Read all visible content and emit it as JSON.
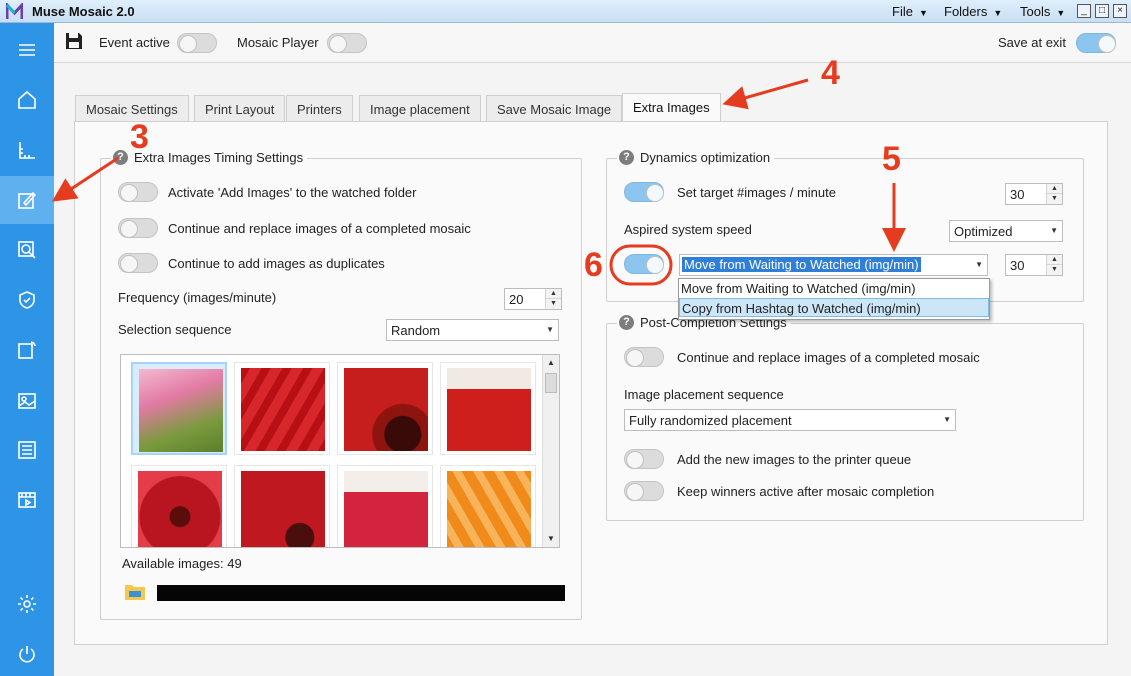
{
  "app": {
    "title": "Muse Mosaic 2.0",
    "menus": [
      "File",
      "Folders",
      "Tools"
    ],
    "window_controls": [
      "_",
      "□",
      "×"
    ]
  },
  "toolbar": {
    "event_active_label": "Event active",
    "mosaic_player_label": "Mosaic Player",
    "save_at_exit_label": "Save at exit"
  },
  "tabs": [
    "Mosaic Settings",
    "Print Layout",
    "Printers",
    "Image placement",
    "Save Mosaic Image",
    "Extra Images"
  ],
  "active_tab": "Extra Images",
  "timing": {
    "title": "Extra Images Timing Settings",
    "activate_label": "Activate 'Add Images' to the watched folder",
    "continue_replace_label": "Continue and replace images of a completed mosaic",
    "continue_duplicates_label": "Continue to add images as duplicates",
    "frequency_label": "Frequency (images/minute)",
    "frequency_value": "20",
    "selection_label": "Selection sequence",
    "selection_value": "Random",
    "available_label": "Available images: 49"
  },
  "dynamics": {
    "title": "Dynamics optimization",
    "target_label": "Set target #images / minute",
    "target_value": "30",
    "speed_label": "Aspired system speed",
    "speed_value": "Optimized",
    "move_select_value": "Move from Waiting to Watched (img/min)",
    "move_value": "30",
    "dropdown_options": [
      "Move from Waiting to Watched (img/min)",
      "Copy from Hashtag to Watched (img/min)"
    ]
  },
  "post": {
    "title": "Post-Completion Settings",
    "continue_replace_label": "Continue and replace images of a completed mosaic",
    "placement_label": "Image placement sequence",
    "placement_value": "Fully randomized placement",
    "printer_queue_label": "Add the new images to the printer queue",
    "keep_winners_label": "Keep winners active after mosaic completion"
  },
  "annotations": [
    "3",
    "4",
    "5",
    "6"
  ],
  "colors": {
    "sidebar": "#2e94e6",
    "accent_red": "#e53b1e",
    "toggle_on": "#8cc6ef"
  }
}
